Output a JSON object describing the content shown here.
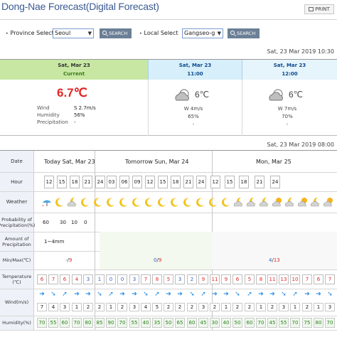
{
  "header": {
    "title": "Dong-Nae Forecast(Digital Forecast)",
    "print_label": "PRINT"
  },
  "search": {
    "province_label": "Province Select",
    "province_value": "Seoul",
    "search_label": "SEARCH",
    "local_label": "Local Select",
    "local_value": "Gangseo-g",
    "search_label_2": "SEARCH"
  },
  "current": {
    "timestamp": "Sat, 23 Mar 2019 10:30",
    "col1_date": "Sat, Mar 23",
    "col1_sub": "Current",
    "col2_date": "Sat, Mar 23",
    "col2_sub": "11:00",
    "col3_date": "Sat, Mar 23",
    "col3_sub": "12:00",
    "temp": "6.7℃",
    "wind_label": "Wind",
    "wind_value": "S 2.7m/s",
    "humidity_label": "Humidity",
    "humidity_value": "56%",
    "precip_label": "Precipitation",
    "precip_value": "-",
    "f1_temp": "6℃",
    "f1_wind": "W 4m/s",
    "f1_hum": "65%",
    "f1_precip": "-",
    "f2_temp": "6℃",
    "f2_wind": "W 7m/s",
    "f2_hum": "70%",
    "f2_precip": "-"
  },
  "digital": {
    "timestamp": "Sat, 23 Mar 2019 08:00",
    "labels": {
      "date": "Date",
      "hour": "Hour",
      "weather": "Weather",
      "pop": "Probability of Precipitation(%)",
      "amount": "Amount of Precipitation",
      "minmax": "Min/Max(℃)",
      "temperature": "Temperature (℃)",
      "wind": "Wind(m/s)",
      "humidity": "Humidity(%)"
    },
    "days": {
      "today": "Today Sat, Mar 23",
      "tomorrow": "Tomorrow Sun, Mar 24",
      "day3": "Mon, Mar 25"
    },
    "hours": [
      "12",
      "15",
      "18",
      "21",
      "24",
      "03",
      "06",
      "09",
      "12",
      "15",
      "18",
      "21",
      "24",
      "12",
      "15",
      "18",
      "21",
      "24"
    ],
    "pop": [
      "60",
      "30",
      "10",
      "0"
    ],
    "amount": "1~4mm",
    "minmax": [
      {
        "min": "-",
        "max": "9"
      },
      {
        "min": "0",
        "max": "9"
      },
      {
        "min": "4",
        "max": "13"
      }
    ],
    "temps": [
      "6",
      "7",
      "6",
      "4",
      "3",
      "1",
      "0",
      "0",
      "3",
      "7",
      "8",
      "5",
      "3",
      "2",
      "9",
      "11",
      "9",
      "6",
      "5",
      "8",
      "11",
      "13",
      "10",
      "7",
      "6",
      "7"
    ],
    "winds": [
      "7",
      "4",
      "3",
      "1",
      "2",
      "2",
      "1",
      "2",
      "3",
      "4",
      "5",
      "2",
      "2",
      "2",
      "3",
      "2",
      "1",
      "2",
      "2",
      "1",
      "2",
      "3",
      "1",
      "2",
      "1",
      "3"
    ],
    "humidity": [
      "70",
      "55",
      "60",
      "70",
      "80",
      "85",
      "90",
      "70",
      "55",
      "40",
      "35",
      "50",
      "65",
      "60",
      "45",
      "30",
      "40",
      "50",
      "60",
      "70",
      "45",
      "55",
      "70",
      "75",
      "80",
      "70"
    ]
  }
}
